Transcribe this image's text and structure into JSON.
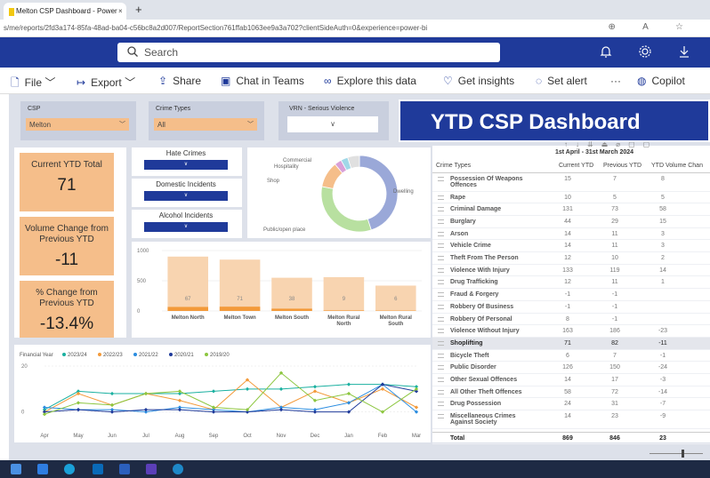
{
  "browser": {
    "tab_title": "Melton CSP Dashboard - Power",
    "tab_close": "×",
    "new_tab": "+",
    "url": "s/me/reports/2fd3a174-85fa-48ad-ba04-c56bc8a2d007/ReportSection761ffab1063ee9a3a702?clientSideAuth=0&experience=power-bi",
    "address_icons": "⊕ A ☆"
  },
  "header": {
    "search_placeholder": "Search",
    "bell_icon": "bell-icon",
    "gear_icon": "gear-icon",
    "download_icon": "download-icon",
    "color": "#1f3a9a"
  },
  "toolbar": {
    "file": "File",
    "export": "Export",
    "share": "Share",
    "chat": "Chat in Teams",
    "explore": "Explore this data",
    "insights": "Get insights",
    "alert": "Set alert",
    "more": "···",
    "copilot": "Copilot"
  },
  "slicers": {
    "csp": {
      "label": "CSP",
      "value": "Melton"
    },
    "crime_types": {
      "label": "Crime Types",
      "value": "All"
    },
    "vrn": {
      "label": "VRN - Serious Violence",
      "value": "∨"
    }
  },
  "title": "YTD CSP Dashboard",
  "kpis": [
    {
      "title": "Current YTD Total",
      "value": "71"
    },
    {
      "title": "Volume Change from Previous YTD",
      "value": "-11"
    },
    {
      "title": "% Change from Previous YTD",
      "value": "-13.4%"
    }
  ],
  "mini_slicers": [
    {
      "label": "Hate Crimes",
      "value": "∨"
    },
    {
      "label": "Domestic Incidents",
      "value": "∨"
    },
    {
      "label": "Alcohol Incidents",
      "value": "∨"
    }
  ],
  "donut": {
    "labels": [
      {
        "text": "Commercial"
      },
      {
        "text": "Hospitality"
      },
      {
        "text": "Shop"
      },
      {
        "text": "Dwelling"
      },
      {
        "text": "Public/open place"
      }
    ],
    "slices": [
      {
        "name": "Dwelling",
        "value": 45,
        "color": "#9aa8d8"
      },
      {
        "name": "Public/open place",
        "value": 33,
        "color": "#b8e0a0"
      },
      {
        "name": "Shop",
        "value": 11,
        "color": "#f5be8a"
      },
      {
        "name": "Hospitality",
        "value": 3,
        "color": "#d9a0d8"
      },
      {
        "name": "Commercial",
        "value": 3,
        "color": "#a0d8e8"
      },
      {
        "name": "Other",
        "value": 5,
        "color": "#e0e0e0"
      }
    ]
  },
  "chart_data": [
    {
      "type": "bar",
      "categories": [
        "Melton North",
        "Melton Town",
        "Melton South",
        "Melton Rural North",
        "Melton Rural South"
      ],
      "series": [
        {
          "values": [
            900,
            850,
            550,
            560,
            420
          ],
          "color": "#f8d4b0"
        },
        {
          "values": [
            67,
            71,
            38,
            9,
            6
          ],
          "color": "#f39a3a"
        }
      ],
      "data_labels": [
        "67",
        "71",
        "38",
        "9",
        "6"
      ],
      "ylim": [
        0,
        1000
      ],
      "yticks": [
        "1000",
        "500",
        "0"
      ]
    },
    {
      "type": "line",
      "legend_title": "Financial Year",
      "categories": [
        "Apr",
        "May",
        "Jun",
        "Jul",
        "Aug",
        "Sep",
        "Oct",
        "Nov",
        "Dec",
        "Jan",
        "Feb",
        "Mar"
      ],
      "ylim": [
        -4,
        20
      ],
      "yticks": [
        "20",
        "0"
      ],
      "series": [
        {
          "name": "2023/24",
          "color": "#1ab0a0",
          "values": [
            1,
            9,
            8,
            8,
            8,
            9,
            10,
            10,
            11,
            12,
            12,
            11
          ]
        },
        {
          "name": "2022/23",
          "color": "#f39a3a",
          "values": [
            0,
            8,
            3,
            8,
            5,
            1,
            14,
            2,
            9,
            4,
            10,
            2
          ]
        },
        {
          "name": "2021/22",
          "color": "#2a8ce0",
          "values": [
            2,
            1,
            1,
            0,
            2,
            1,
            0,
            2,
            1,
            4,
            12,
            0
          ]
        },
        {
          "name": "2020/21",
          "color": "#1f3a9a",
          "values": [
            0,
            1,
            0,
            1,
            1,
            0,
            0,
            1,
            0,
            0,
            12,
            9
          ]
        },
        {
          "name": "2019/20",
          "color": "#8cc63f",
          "values": [
            -1,
            4,
            3,
            8,
            9,
            2,
            1,
            17,
            5,
            8,
            0,
            10
          ]
        }
      ]
    }
  ],
  "table": {
    "period": "1st April - 31st March 2024",
    "headers": [
      "Crime Types",
      "Current YTD",
      "Previous YTD",
      "YTD Volume Chan"
    ],
    "rows": [
      {
        "name": "Possession Of Weapons",
        "name2": "Offences",
        "c": "15",
        "p": "7",
        "v": "8"
      },
      {
        "name": "Rape",
        "c": "10",
        "p": "5",
        "v": "5"
      },
      {
        "name": "Criminal Damage",
        "c": "131",
        "p": "73",
        "v": "58"
      },
      {
        "name": "Burglary",
        "c": "44",
        "p": "29",
        "v": "15"
      },
      {
        "name": "Arson",
        "c": "14",
        "p": "11",
        "v": "3"
      },
      {
        "name": "Vehicle Crime",
        "c": "14",
        "p": "11",
        "v": "3"
      },
      {
        "name": "Theft From The Person",
        "c": "12",
        "p": "10",
        "v": "2"
      },
      {
        "name": "Violence With Injury",
        "c": "133",
        "p": "119",
        "v": "14"
      },
      {
        "name": "Drug Trafficking",
        "c": "12",
        "p": "11",
        "v": "1"
      },
      {
        "name": "Fraud & Forgery",
        "c": "-1",
        "p": "-1",
        "v": ""
      },
      {
        "name": "Robbery Of Business",
        "c": "-1",
        "p": "-1",
        "v": ""
      },
      {
        "name": "Robbery Of Personal",
        "c": "8",
        "p": "-1",
        "v": ""
      },
      {
        "name": "Violence Without Injury",
        "c": "163",
        "p": "186",
        "v": "-23"
      },
      {
        "name": "Shoplifting",
        "c": "71",
        "p": "82",
        "v": "-11",
        "highlight": true
      },
      {
        "name": "Bicycle Theft",
        "c": "6",
        "p": "7",
        "v": "-1"
      },
      {
        "name": "Public Disorder",
        "c": "126",
        "p": "150",
        "v": "-24"
      },
      {
        "name": "Other Sexual Offences",
        "c": "14",
        "p": "17",
        "v": "-3"
      },
      {
        "name": "All Other Theft Offences",
        "c": "58",
        "p": "72",
        "v": "-14"
      },
      {
        "name": "Drug Possession",
        "c": "24",
        "p": "31",
        "v": "-7"
      },
      {
        "name": "Miscellaneous Crimes",
        "name2": "Against Society",
        "c": "14",
        "p": "23",
        "v": "-9"
      }
    ],
    "total": {
      "name": "Total",
      "c": "869",
      "p": "846",
      "v": "23"
    }
  }
}
